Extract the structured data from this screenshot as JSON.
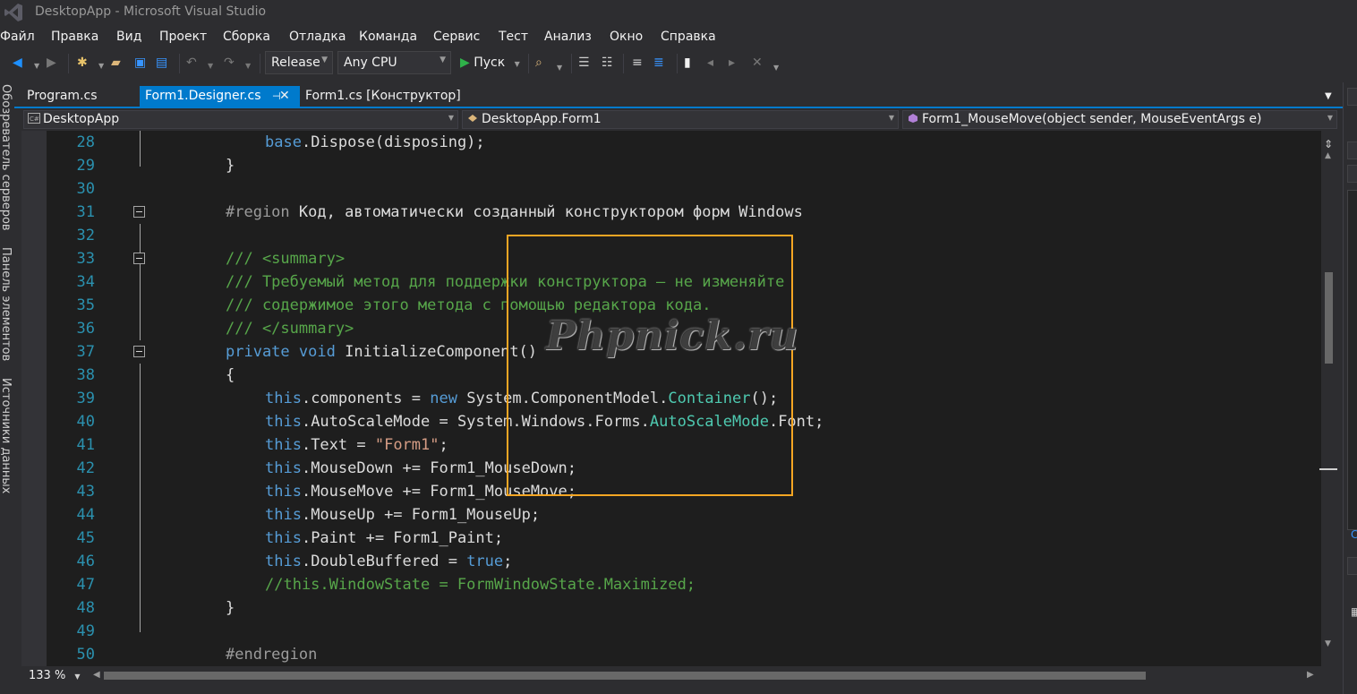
{
  "window": {
    "title": "DesktopApp - Microsoft Visual Studio"
  },
  "menu": [
    "Файл",
    "Правка",
    "Вид",
    "Проект",
    "Сборка",
    "Отладка",
    "Команда",
    "Сервис",
    "Тест",
    "Анализ",
    "Окно",
    "Справка"
  ],
  "toolbar": {
    "configuration": "Release",
    "platform": "Any CPU",
    "run_label": "Пуск",
    "icons": [
      "back-icon",
      "forward-icon",
      "new-project-icon",
      "open-folder-icon",
      "save-icon",
      "save-all-icon",
      "undo-icon",
      "redo-icon",
      "find-in-files-icon",
      "comment-icon",
      "uncomment-icon",
      "indent-icon",
      "outdent-icon",
      "bookmark-icon",
      "prev-bookmark-icon",
      "next-bookmark-icon",
      "clear-bookmarks-icon"
    ]
  },
  "sidebar": {
    "tabs": [
      "Обозреватель серверов",
      "Панель элементов",
      "Источники данных"
    ]
  },
  "tabs": [
    {
      "label": "Program.cs",
      "active": false
    },
    {
      "label": "Form1.Designer.cs",
      "active": true
    },
    {
      "label": "Form1.cs [Конструктор]",
      "active": false
    }
  ],
  "navbar": {
    "project": "DesktopApp",
    "type": "DesktopApp.Form1",
    "member": "Form1_MouseMove(object sender, MouseEventArgs e)"
  },
  "editor": {
    "lines": [
      {
        "n": "28",
        "text": "base.Dispose(disposing);"
      },
      {
        "n": "29",
        "text": "}"
      },
      {
        "n": "30",
        "text": ""
      },
      {
        "n": "31",
        "text": "#region Код, автоматически созданный конструктором форм Windows"
      },
      {
        "n": "32",
        "text": ""
      },
      {
        "n": "33",
        "text": "/// <summary>"
      },
      {
        "n": "34",
        "text": "/// Требуемый метод для поддержки конструктора — не изменяйте"
      },
      {
        "n": "35",
        "text": "/// содержимое этого метода с помощью редактора кода."
      },
      {
        "n": "36",
        "text": "/// </summary>"
      },
      {
        "n": "37",
        "text": "private void InitializeComponent()"
      },
      {
        "n": "38",
        "text": "{"
      },
      {
        "n": "39",
        "text": "this.components = new System.ComponentModel.Container();"
      },
      {
        "n": "40",
        "text": "this.AutoScaleMode = System.Windows.Forms.AutoScaleMode.Font;"
      },
      {
        "n": "41",
        "text": "this.Text = \"Form1\";"
      },
      {
        "n": "42",
        "text": "this.MouseDown += Form1_MouseDown;"
      },
      {
        "n": "43",
        "text": "this.MouseMove += Form1_MouseMove;"
      },
      {
        "n": "44",
        "text": "this.MouseUp += Form1_MouseUp;"
      },
      {
        "n": "45",
        "text": "this.Paint += Form1_Paint;"
      },
      {
        "n": "46",
        "text": "this.DoubleBuffered = true;"
      },
      {
        "n": "47",
        "text": "//this.WindowState = FormWindowState.Maximized;"
      },
      {
        "n": "48",
        "text": "}"
      },
      {
        "n": "49",
        "text": ""
      },
      {
        "n": "50",
        "text": "#endregion"
      }
    ],
    "watermark": "Phpnick.ru"
  },
  "statusbar": {
    "zoom": "133 %"
  },
  "colors": {
    "accent": "#007acc",
    "keyword": "#569cd6",
    "comment": "#57a64a",
    "type": "#4ec9b0",
    "string": "#d69d85",
    "line_number": "#2b91af",
    "highlight_box": "#f5a623"
  }
}
